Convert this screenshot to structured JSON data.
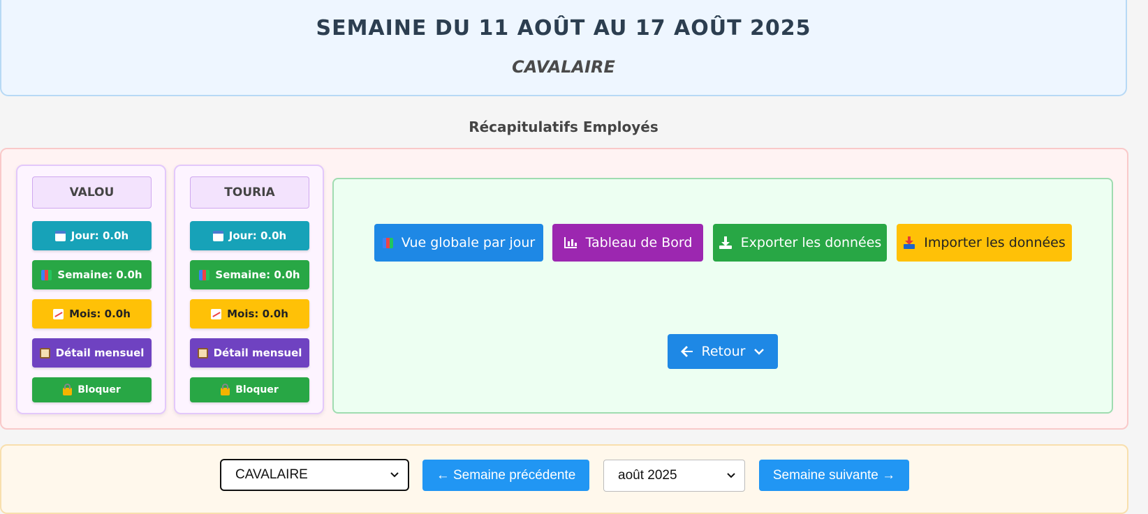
{
  "header": {
    "title": "SEMAINE DU 11 AOÛT AU 17 AOÛT 2025",
    "subtitle": "CAVALAIRE"
  },
  "recap": {
    "title": "Récapitulatifs Employés",
    "employees": [
      {
        "name": "VALOU",
        "jour": "Jour: 0.0h",
        "semaine": "Semaine: 0.0h",
        "mois": "Mois: 0.0h",
        "detail": "Détail mensuel",
        "bloquer": "Bloquer"
      },
      {
        "name": "TOURIA",
        "jour": "Jour: 0.0h",
        "semaine": "Semaine: 0.0h",
        "mois": "Mois: 0.0h",
        "detail": "Détail mensuel",
        "bloquer": "Bloquer"
      }
    ]
  },
  "actions": {
    "vue_globale": "Vue globale par jour",
    "tableau_bord": "Tableau de Bord",
    "exporter": "Exporter les données",
    "importer": "Importer les données",
    "retour": "Retour"
  },
  "bottom": {
    "site_select": "CAVALAIRE",
    "prev_week": "← Semaine précédente",
    "month_select": "août 2025",
    "next_week": "Semaine suivante →"
  },
  "colors": {
    "teal": "#17a2b8",
    "green": "#28a745",
    "yellow": "#ffc107",
    "purple": "#6f42c1",
    "blue": "#1e88e5",
    "magenta": "#9c27b0"
  }
}
